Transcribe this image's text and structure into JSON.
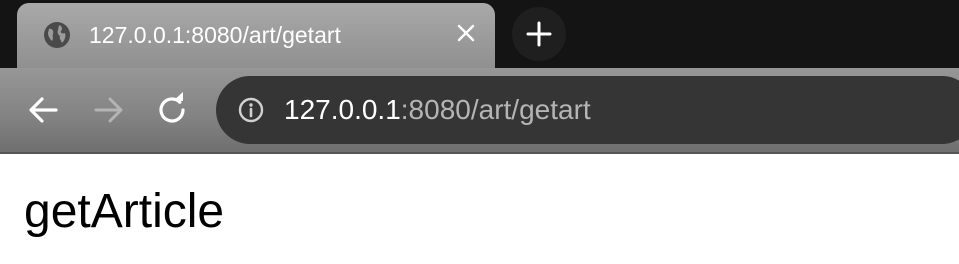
{
  "tab": {
    "title": "127.0.0.1:8080/art/getart",
    "favicon_icon": "globe-icon",
    "close_icon": "close-icon"
  },
  "new_tab": {
    "icon": "plus-icon"
  },
  "toolbar": {
    "back_icon": "arrow-left-icon",
    "forward_icon": "arrow-right-icon",
    "reload_icon": "reload-icon",
    "info_icon": "info-icon"
  },
  "address_bar": {
    "host": "127.0.0.1",
    "rest": ":8080/art/getart"
  },
  "page": {
    "heading": "getArticle"
  },
  "colors": {
    "tab_strip": "#141414",
    "active_tab": "#9e9e9e",
    "toolbar": "#858585",
    "omnibox": "#353535",
    "url_host": "#ffffff",
    "url_rest": "#b5b5b5"
  }
}
